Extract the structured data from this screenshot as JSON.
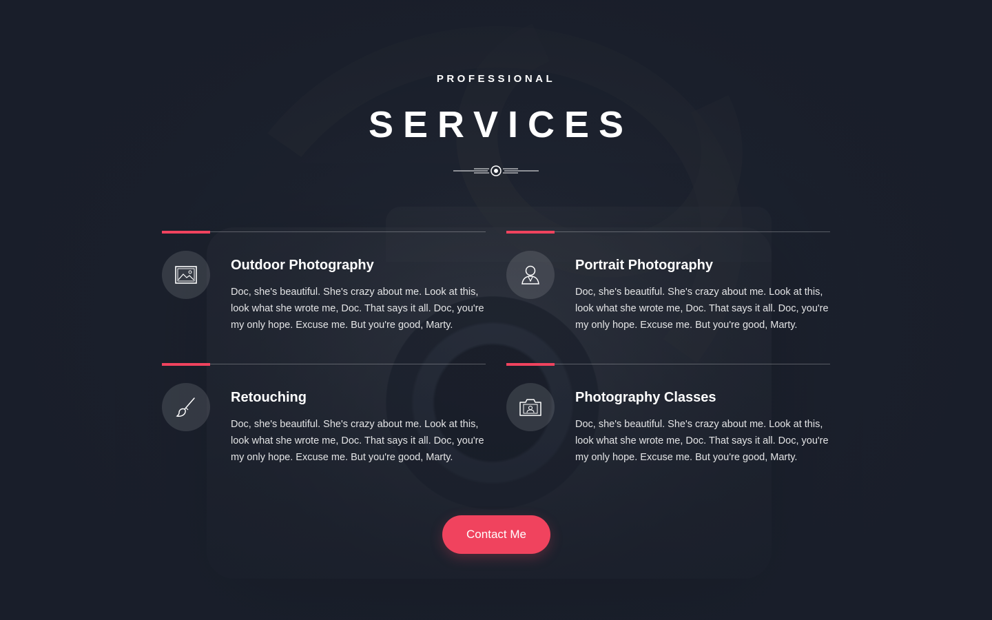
{
  "header": {
    "eyebrow": "PROFESSIONAL",
    "title": "SERVICES"
  },
  "services": [
    {
      "title": "Outdoor Photography",
      "icon": "landscape-image-icon",
      "description": "Doc, she's beautiful. She's crazy about me. Look at this, look what she wrote me, Doc. That says it all. Doc, you're my only hope. Excuse me. But you're good, Marty."
    },
    {
      "title": "Portrait Photography",
      "icon": "person-portrait-icon",
      "description": "Doc, she's beautiful. She's crazy about me. Look at this, look what she wrote me, Doc. That says it all. Doc, you're my only hope. Excuse me. But you're good, Marty."
    },
    {
      "title": "Retouching",
      "icon": "brush-icon",
      "description": "Doc, she's beautiful. She's crazy about me. Look at this, look what she wrote me, Doc. That says it all. Doc, you're my only hope. Excuse me. But you're good, Marty."
    },
    {
      "title": "Photography Classes",
      "icon": "camera-portrait-icon",
      "description": "Doc, she's beautiful. She's crazy about me. Look at this, look what she wrote me, Doc. That says it all. Doc, you're my only hope. Excuse me. But you're good, Marty."
    }
  ],
  "cta": {
    "label": "Contact Me"
  },
  "colors": {
    "accent": "#f0435e",
    "background": "#1f2532",
    "text": "#ffffff"
  }
}
